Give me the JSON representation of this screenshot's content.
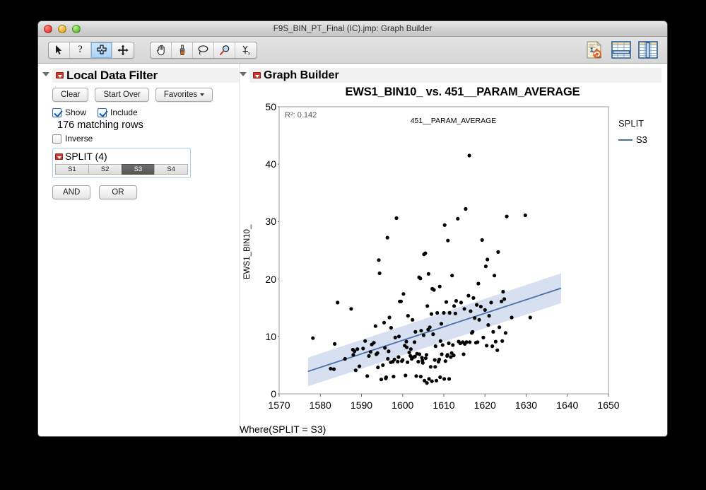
{
  "window": {
    "title": "F9S_BIN_PT_Final (IC).jmp: Graph Builder",
    "controls": [
      "close-button",
      "minimize-button",
      "zoom-button"
    ]
  },
  "toolbar": {
    "group_one": [
      {
        "name": "arrow-select-tool",
        "icon": "arrow-icon",
        "selected": false
      },
      {
        "name": "help-tool",
        "icon": "question-mark-icon",
        "selected": false
      },
      {
        "name": "crosshair-tool",
        "icon": "crosshair-icon",
        "selected": true
      },
      {
        "name": "pan-move-tool",
        "icon": "four-arrows-icon",
        "selected": false
      }
    ],
    "group_two": [
      {
        "name": "grabber-tool",
        "icon": "hand-icon",
        "selected": false
      },
      {
        "name": "brush-tool",
        "icon": "brush-icon",
        "selected": false
      },
      {
        "name": "lasso-tool",
        "icon": "lasso-icon",
        "selected": false
      },
      {
        "name": "magnifier-tool",
        "icon": "magnifier-icon",
        "selected": false
      },
      {
        "name": "annotate-tool",
        "icon": "crosshairs-x-icon",
        "selected": false
      }
    ],
    "right_icons": [
      {
        "name": "rerun-script-button",
        "icon": "jmp-document-refresh-icon"
      },
      {
        "name": "row-selection-button",
        "icon": "table-rows-icon"
      },
      {
        "name": "column-selection-button",
        "icon": "table-columns-icon"
      }
    ]
  },
  "local_data_filter": {
    "title": "Local Data Filter",
    "buttons": [
      {
        "label": "Clear",
        "name": "clear-button",
        "has_caret": false
      },
      {
        "label": "Start Over",
        "name": "start-over-button",
        "has_caret": false
      },
      {
        "label": "Favorites",
        "name": "favorites-button",
        "has_caret": true
      }
    ],
    "show_label": "Show",
    "show_checked": true,
    "include_label": "Include",
    "include_checked": true,
    "matching_rows": "176 matching rows",
    "inverse_label": "Inverse",
    "inverse_checked": false,
    "filter_column": {
      "title": "SPLIT (4)",
      "values": [
        "S1",
        "S2",
        "S3",
        "S4"
      ],
      "selected": "S3"
    },
    "logic_buttons": [
      {
        "label": "AND",
        "name": "and-button"
      },
      {
        "label": "OR",
        "name": "or-button"
      }
    ]
  },
  "graph_builder": {
    "title": "Graph Builder",
    "caption": "Where(SPLIT = S3)"
  },
  "chart_data": {
    "type": "scatter",
    "title": "EWS1_BIN10_ vs. 451__PARAM_AVERAGE",
    "xlabel": "451__PARAM_AVERAGE",
    "ylabel": "EWS1_BIN10_",
    "xlim": [
      1570,
      1650
    ],
    "ylim": [
      0,
      50
    ],
    "xticks": [
      1570,
      1580,
      1590,
      1600,
      1610,
      1620,
      1630,
      1640,
      1650
    ],
    "yticks": [
      0,
      10,
      20,
      30,
      40,
      50
    ],
    "grid": false,
    "annotation": "R²: 0.142",
    "r_squared": 0.142,
    "legend": {
      "title": "SPLIT",
      "position": "right",
      "entries": [
        {
          "label": "S3",
          "color": "#4a6fa8",
          "marker": "line"
        }
      ]
    },
    "series": [
      {
        "name": "S3",
        "marker_color": "#000000",
        "points": [
          [
            1578.2,
            9.7
          ],
          [
            1582.5,
            4.4
          ],
          [
            1583.5,
            8.7
          ],
          [
            1583.3,
            4.3
          ],
          [
            1584.2,
            15.9
          ],
          [
            1586.0,
            6.1
          ],
          [
            1587.5,
            14.8
          ],
          [
            1588.3,
            7.4
          ],
          [
            1589.0,
            7.8
          ],
          [
            1588.0,
            6.8
          ],
          [
            1589.5,
            4.8
          ],
          [
            1588.6,
            4.1
          ],
          [
            1590.4,
            7.9
          ],
          [
            1590.9,
            9.2
          ],
          [
            1591.4,
            3.1
          ],
          [
            1592.5,
            8.6
          ],
          [
            1593.0,
            8.9
          ],
          [
            1592.2,
            7.3
          ],
          [
            1593.4,
            11.8
          ],
          [
            1593.6,
            6.9
          ],
          [
            1594.2,
            23.3
          ],
          [
            1594.4,
            21.0
          ],
          [
            1594.0,
            4.6
          ],
          [
            1594.8,
            2.5
          ],
          [
            1595.5,
            12.4
          ],
          [
            1595.7,
            8.0
          ],
          [
            1595.2,
            5.0
          ],
          [
            1595.9,
            2.7
          ],
          [
            1596.3,
            27.2
          ],
          [
            1596.8,
            13.3
          ],
          [
            1596.4,
            6.1
          ],
          [
            1596.0,
            2.9
          ],
          [
            1597.2,
            11.5
          ],
          [
            1597.6,
            5.6
          ],
          [
            1597.1,
            5.5
          ],
          [
            1597.8,
            3.0
          ],
          [
            1598.5,
            30.6
          ],
          [
            1598.2,
            9.8
          ],
          [
            1598.0,
            6.0
          ],
          [
            1598.8,
            5.6
          ],
          [
            1599.3,
            16.1
          ],
          [
            1599.6,
            16.1
          ],
          [
            1599.1,
            10.0
          ],
          [
            1599.8,
            5.7
          ],
          [
            1600.2,
            17.4
          ],
          [
            1600.5,
            8.4
          ],
          [
            1600.0,
            5.9
          ],
          [
            1600.7,
            3.2
          ],
          [
            1601.3,
            13.6
          ],
          [
            1601.0,
            8.1
          ],
          [
            1601.6,
            7.2
          ],
          [
            1601.2,
            5.5
          ],
          [
            1602.4,
            12.9
          ],
          [
            1602.0,
            7.8
          ],
          [
            1602.7,
            6.4
          ],
          [
            1602.2,
            6.1
          ],
          [
            1603.1,
            10.8
          ],
          [
            1603.5,
            7.0
          ],
          [
            1603.0,
            6.5
          ],
          [
            1603.8,
            5.6
          ],
          [
            1604.0,
            20.3
          ],
          [
            1604.3,
            20.1
          ],
          [
            1604.5,
            11.0
          ],
          [
            1604.1,
            6.9
          ],
          [
            1604.7,
            6.3
          ],
          [
            1604.9,
            5.4
          ],
          [
            1604.4,
            3.0
          ],
          [
            1605.2,
            24.3
          ],
          [
            1605.5,
            24.5
          ],
          [
            1605.1,
            10.2
          ],
          [
            1605.8,
            6.8
          ],
          [
            1605.3,
            2.3
          ],
          [
            1605.9,
            1.9
          ],
          [
            1606.3,
            20.9
          ],
          [
            1606.0,
            15.3
          ],
          [
            1606.6,
            11.6
          ],
          [
            1606.2,
            11.2
          ],
          [
            1606.8,
            4.7
          ],
          [
            1606.4,
            2.6
          ],
          [
            1607.2,
            18.3
          ],
          [
            1607.6,
            18.1
          ],
          [
            1607.0,
            13.9
          ],
          [
            1607.4,
            10.4
          ],
          [
            1607.9,
            4.7
          ],
          [
            1607.1,
            2.2
          ],
          [
            1608.4,
            14.1
          ],
          [
            1608.0,
            8.3
          ],
          [
            1608.7,
            5.6
          ],
          [
            1608.2,
            2.3
          ],
          [
            1609.0,
            18.7
          ],
          [
            1609.4,
            12.2
          ],
          [
            1609.2,
            9.2
          ],
          [
            1609.7,
            8.5
          ],
          [
            1609.5,
            6.9
          ],
          [
            1609.1,
            2.9
          ],
          [
            1610.2,
            29.4
          ],
          [
            1610.6,
            16.0
          ],
          [
            1610.0,
            14.1
          ],
          [
            1610.8,
            6.6
          ],
          [
            1610.4,
            5.7
          ],
          [
            1610.1,
            2.6
          ],
          [
            1611.0,
            26.7
          ],
          [
            1611.4,
            14.1
          ],
          [
            1611.2,
            8.8
          ],
          [
            1611.7,
            6.4
          ],
          [
            1611.3,
            2.6
          ],
          [
            1612.0,
            20.6
          ],
          [
            1612.5,
            15.3
          ],
          [
            1612.2,
            8.5
          ],
          [
            1613.4,
            30.5
          ],
          [
            1613.0,
            16.2
          ],
          [
            1613.6,
            9.1
          ],
          [
            1614.2,
            15.9
          ],
          [
            1614.6,
            9.0
          ],
          [
            1614.0,
            8.8
          ],
          [
            1615.3,
            32.2
          ],
          [
            1615.0,
            14.8
          ],
          [
            1615.5,
            9.0
          ],
          [
            1615.1,
            8.7
          ],
          [
            1616.2,
            41.5
          ],
          [
            1616.0,
            17.1
          ],
          [
            1616.5,
            14.4
          ],
          [
            1616.8,
            10.6
          ],
          [
            1616.3,
            9.0
          ],
          [
            1617.2,
            16.7
          ],
          [
            1617.5,
            13.2
          ],
          [
            1617.0,
            10.8
          ],
          [
            1617.8,
            8.9
          ],
          [
            1618.4,
            19.2
          ],
          [
            1618.0,
            15.5
          ],
          [
            1618.6,
            12.9
          ],
          [
            1618.2,
            9.0
          ],
          [
            1619.3,
            26.8
          ],
          [
            1619.0,
            15.2
          ],
          [
            1619.6,
            9.8
          ],
          [
            1620.2,
            22.2
          ],
          [
            1620.6,
            23.4
          ],
          [
            1620.0,
            14.6
          ],
          [
            1620.8,
            12.0
          ],
          [
            1620.4,
            8.4
          ],
          [
            1621.5,
            15.9
          ],
          [
            1621.0,
            13.6
          ],
          [
            1621.8,
            8.3
          ],
          [
            1622.3,
            20.6
          ],
          [
            1622.0,
            10.8
          ],
          [
            1622.6,
            9.1
          ],
          [
            1623.2,
            24.7
          ],
          [
            1623.5,
            11.6
          ],
          [
            1623.0,
            7.6
          ],
          [
            1624.4,
            17.8
          ],
          [
            1624.0,
            16.1
          ],
          [
            1624.7,
            16.5
          ],
          [
            1624.2,
            9.2
          ],
          [
            1625.3,
            30.9
          ],
          [
            1625.0,
            10.6
          ],
          [
            1626.5,
            13.3
          ],
          [
            1629.8,
            31.1
          ],
          [
            1631.0,
            13.3
          ],
          [
            1612.8,
            14.0
          ],
          [
            1600.9,
            9.1
          ],
          [
            1602.9,
            9.0
          ],
          [
            1612.4,
            6.7
          ],
          [
            1611.9,
            7.1
          ],
          [
            1614.8,
            6.9
          ],
          [
            1587.9,
            7.7
          ],
          [
            1591.8,
            6.6
          ],
          [
            1599.0,
            6.4
          ],
          [
            1605.6,
            6.2
          ],
          [
            1608.9,
            6.0
          ],
          [
            1610.9,
            6.8
          ],
          [
            1593.9,
            7.1
          ],
          [
            1596.6,
            7.4
          ],
          [
            1601.9,
            6.6
          ],
          [
            1604.8,
            5.8
          ],
          [
            1607.8,
            5.9
          ],
          [
            1603.3,
            3.1
          ]
        ]
      }
    ],
    "fit_line": {
      "name": "linear-fit",
      "color": "#4a6fa8",
      "x_start": 1577.0,
      "y_start": 3.9,
      "x_end": 1638.5,
      "y_end": 18.4
    },
    "confidence_band": {
      "color": "#d6e0f0",
      "x_start": 1577.0,
      "x_end": 1638.5,
      "upper_start": 6.3,
      "lower_start": 1.3,
      "upper_end": 21.0,
      "lower_end": 15.8
    }
  }
}
